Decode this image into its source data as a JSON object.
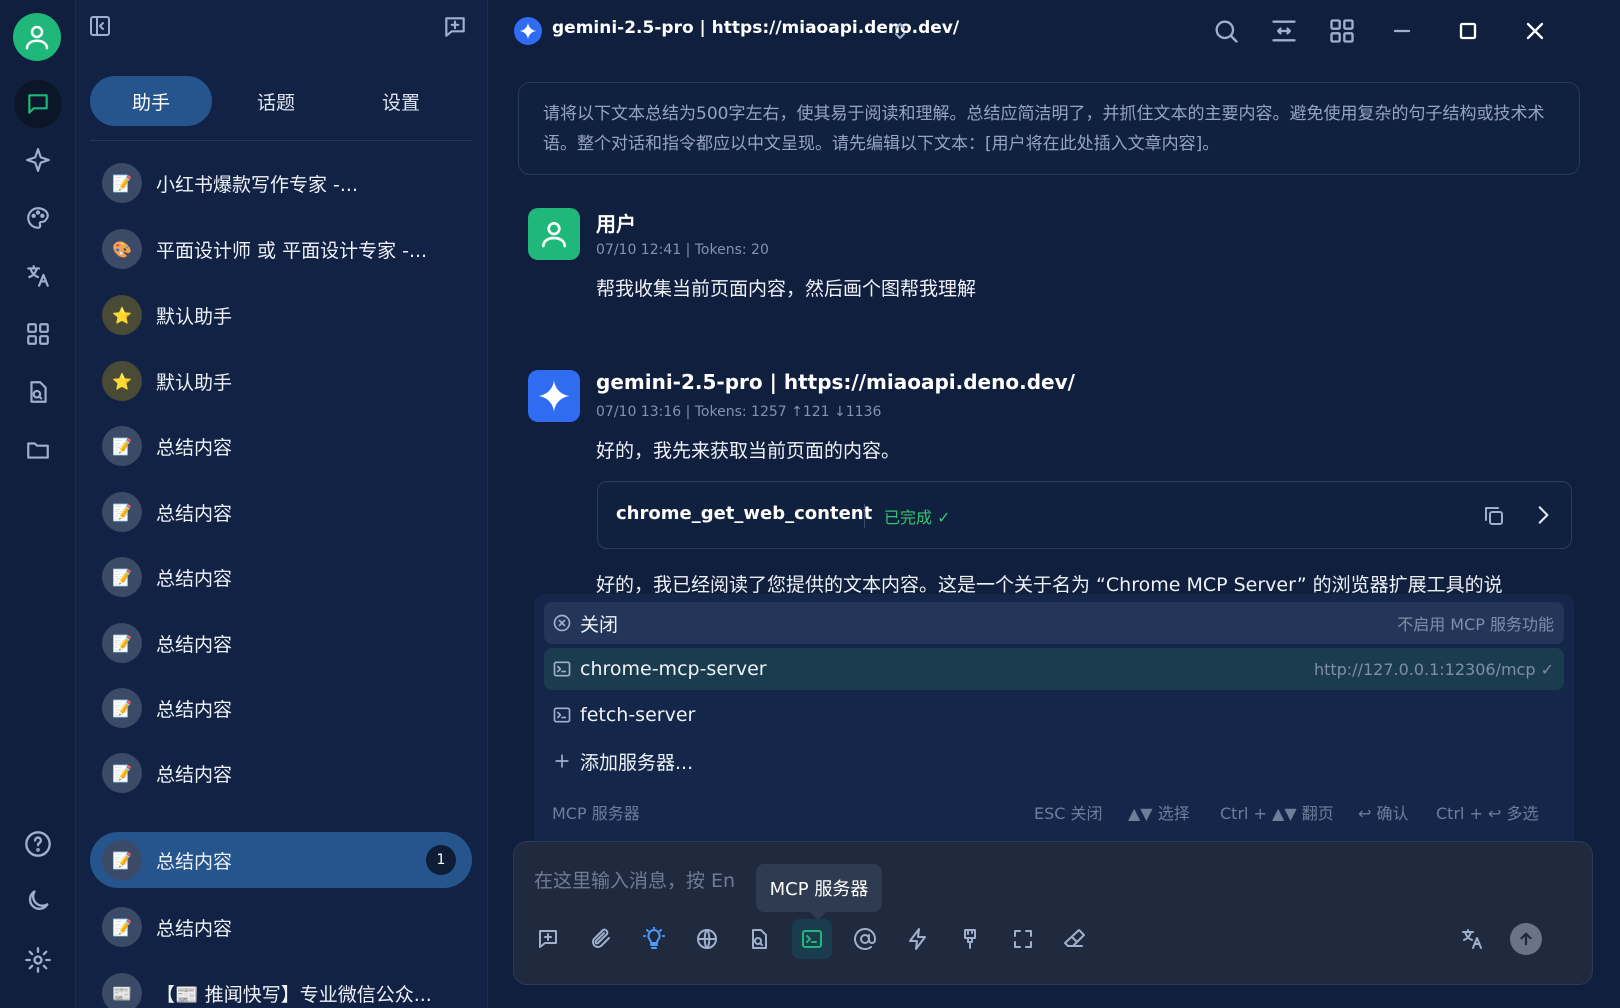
{
  "header": {
    "model_title": "gemini-2.5-pro | https://miaoapi.deno.dev/"
  },
  "panel": {
    "tabs": [
      {
        "label": "助手",
        "active": true
      },
      {
        "label": "话题",
        "active": false
      },
      {
        "label": "设置",
        "active": false
      }
    ],
    "items": [
      {
        "label": "小红书爆款写作专家 -...",
        "icon": "memo-icon"
      },
      {
        "label": "平面设计师 或 平面设计专家 -...",
        "icon": "palette-icon"
      },
      {
        "label": "默认助手",
        "icon": "star-icon"
      },
      {
        "label": "默认助手",
        "icon": "star-icon"
      },
      {
        "label": "总结内容",
        "icon": "memo-icon"
      },
      {
        "label": "总结内容",
        "icon": "memo-icon"
      },
      {
        "label": "总结内容",
        "icon": "memo-icon"
      },
      {
        "label": "总结内容",
        "icon": "memo-icon"
      },
      {
        "label": "总结内容",
        "icon": "memo-icon"
      },
      {
        "label": "总结内容",
        "icon": "memo-icon"
      },
      {
        "label": "总结内容",
        "icon": "memo-icon",
        "active": true,
        "badge": "1"
      },
      {
        "label": "总结内容",
        "icon": "memo-icon"
      },
      {
        "label": "【📰 推闻快写】专业微信公众...",
        "icon": "newspaper-icon"
      }
    ]
  },
  "chat": {
    "prompt": "请将以下文本总结为500字左右，使其易于阅读和理解。总结应简洁明了，并抓住文本的主要内容。避免使用复杂的句子结构或技术术语。整个对话和指令都应以中文呈现。请先编辑以下文本：[用户将在此处插入文章内容]。",
    "user_msg": {
      "name": "用户",
      "meta": "07/10 12:41  |  Tokens: 20",
      "text": "帮我收集当前页面内容，然后画个图帮我理解"
    },
    "ai_msg": {
      "name": "gemini-2.5-pro | https://miaoapi.deno.dev/",
      "meta": "07/10 13:16  |  Tokens: 1257  ↑121  ↓1136",
      "text1": "好的，我先来获取当前页面的内容。",
      "tool_name": "chrome_get_web_content",
      "tool_status": "已完成 ✓",
      "text2": "好的，我已经阅读了您提供的文本内容。这是一个关于名为 “Chrome MCP Server” 的浏览器扩展工具的说"
    }
  },
  "mcp": {
    "rows": [
      {
        "label": "关闭",
        "right": "不启用 MCP 服务功能"
      },
      {
        "label": "chrome-mcp-server",
        "right": "http://127.0.0.1:12306/mcp ✓",
        "selected": true
      },
      {
        "label": "fetch-server",
        "right": ""
      },
      {
        "label": "添加服务器...",
        "right": ""
      }
    ],
    "footer_title": "MCP 服务器",
    "hints": [
      "ESC 关闭",
      "▲▼ 选择",
      "Ctrl + ▲▼ 翻页",
      "↩ 确认",
      "Ctrl + ↩ 多选"
    ]
  },
  "input": {
    "placeholder": "在这里输入消息，按 En",
    "tooltip": "MCP 服务器"
  },
  "colors": {
    "accent": "#26548d",
    "success": "#36c46c",
    "user_avatar": "#1fb77a",
    "gemini_avatar": "#2f6cf2"
  }
}
